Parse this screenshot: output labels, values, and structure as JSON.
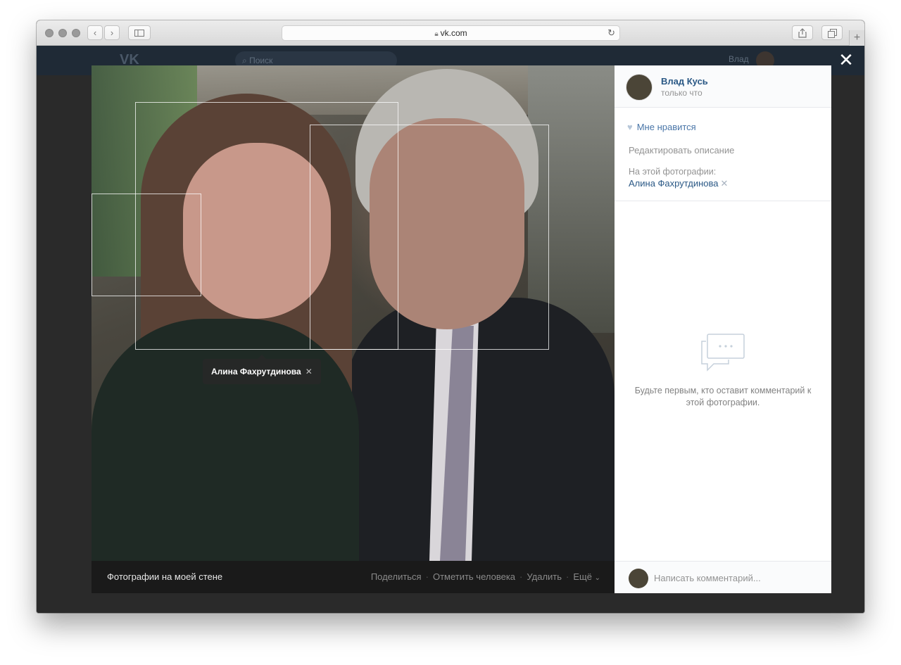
{
  "browser": {
    "url": "vk.com",
    "lock_icon": "lock-icon",
    "reload_icon": "reload-icon",
    "back_icon": "chevron-left-icon",
    "forward_icon": "chevron-right-icon",
    "sidebar_icon": "sidebar-icon",
    "share_icon": "share-icon",
    "tabs_icon": "tabs-icon",
    "new_tab_icon": "plus-icon"
  },
  "vk_page": {
    "logo": "VK",
    "search_placeholder": "Поиск",
    "user_name": "Влад"
  },
  "viewer": {
    "close_icon": "close-icon",
    "photo_tag": {
      "name": "Алина Фахрутдинова",
      "remove": "✕"
    },
    "bottom_bar": {
      "album": "Фотографии на моей стене",
      "actions": [
        "Поделиться",
        "Отметить человека",
        "Удалить",
        "Ещё"
      ],
      "more_chevron": "⌄"
    }
  },
  "side_panel": {
    "author_name": "Влад Кусь",
    "author_time": "только что",
    "like_label": "Мне нравится",
    "edit_description": "Редактировать описание",
    "on_photo_label": "На этой фотографии:",
    "on_photo_person": "Алина Фахрутдинова",
    "remove_mark": "✕",
    "empty_comments_text": "Будьте первым, кто оставит комментарий к этой фотографии.",
    "comment_placeholder": "Написать комментарий..."
  },
  "colors": {
    "link": "#2a5885",
    "accent": "#4a76a8",
    "muted": "#939393",
    "photo_bar": "#1a1a1a"
  }
}
